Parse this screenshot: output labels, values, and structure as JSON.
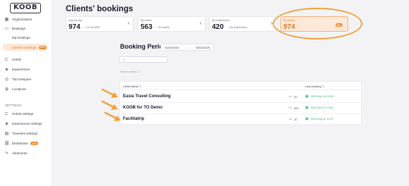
{
  "app": {
    "logo": "KOOB"
  },
  "sidebar": {
    "items": [
      {
        "label": "Organizations",
        "icon": "building-icon"
      },
      {
        "label": "Bookings",
        "icon": "briefcase-icon"
      }
    ],
    "sub_items": [
      {
        "label": "My bookings",
        "badge": ""
      },
      {
        "label": "Clients' bookings",
        "badge": "New"
      }
    ],
    "items2": [
      {
        "label": "Hotels",
        "icon": "bed-icon"
      },
      {
        "label": "Experiences",
        "icon": "compass-icon"
      },
      {
        "label": "Trip Designer",
        "icon": "map-pin-icon"
      },
      {
        "label": "Locations",
        "icon": "globe-icon"
      }
    ],
    "settings_label": "SETTINGS",
    "settings_items": [
      {
        "label": "Hotels settings",
        "icon": "bed-icon",
        "badge": ""
      },
      {
        "label": "Experiences settings",
        "icon": "compass-icon",
        "badge": ""
      },
      {
        "label": "Travelers settings",
        "icon": "users-icon",
        "badge": ""
      },
      {
        "label": "Distribution",
        "icon": "share-icon",
        "badge": "New"
      },
      {
        "label": "Allotments",
        "icon": "bolt-icon",
        "badge": ""
      }
    ]
  },
  "page": {
    "title": "Clients' bookings"
  },
  "kpis": [
    {
      "label": "Day by day",
      "value": "974",
      "meta": "01.04.2025"
    },
    {
      "label": "By hotels",
      "value": "563",
      "meta": "50 hotels"
    },
    {
      "label": "By Experience",
      "value": "420",
      "meta": "By Experience"
    },
    {
      "label": "By clients",
      "value": "974",
      "meta": "",
      "badge": "New"
    }
  ],
  "period": {
    "title": "Booking Period",
    "start": "01/04/2025",
    "end": "30/04/2025"
  },
  "search": {
    "placeholder": "",
    "results_note": "Search results • 3"
  },
  "table": {
    "headers": {
      "client": "Client Name",
      "last": "Last booking"
    },
    "rows": [
      {
        "client": "Easia Travel Consulting",
        "count": "30",
        "last": "2025 Mar 15 09:36"
      },
      {
        "client": "KOOB for TO Demo",
        "count": "602",
        "last": "2025 Apr 02 10:55"
      },
      {
        "client": "Facilitatrip",
        "count": "10",
        "last": "2024 Aug 15 10:07"
      }
    ]
  },
  "colors": {
    "accent": "#f28a2e",
    "highlight": "#f1a23a",
    "success": "#2fb36d"
  }
}
